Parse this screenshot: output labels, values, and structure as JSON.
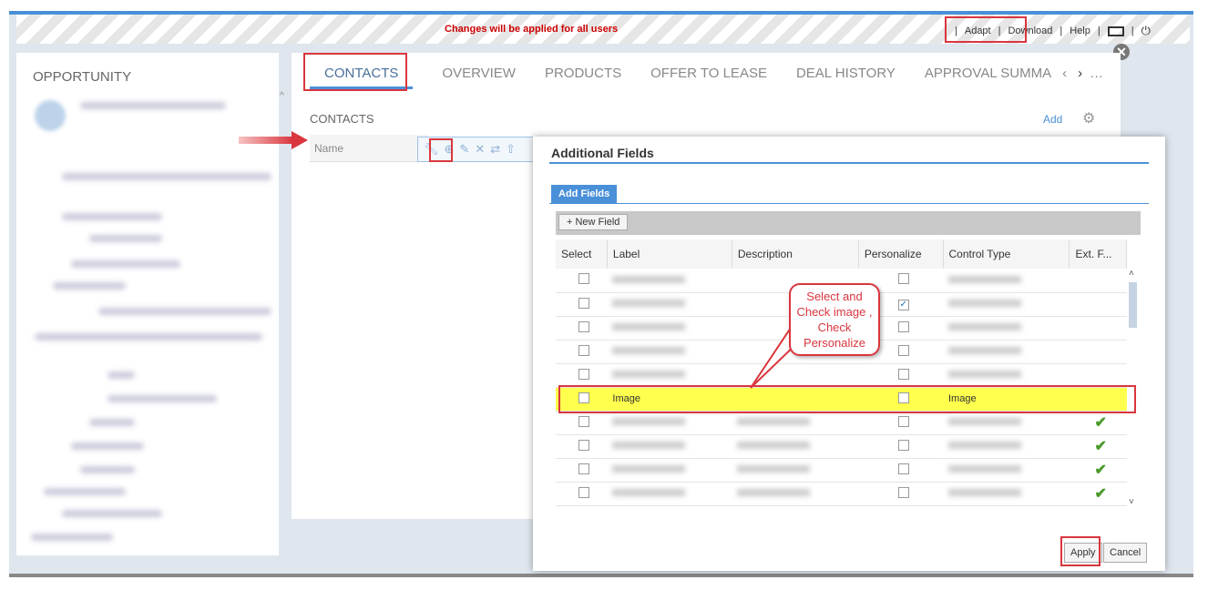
{
  "topbar": {
    "notice": "Changes will be applied for all users",
    "links": [
      "Adapt",
      "Download",
      "Help"
    ]
  },
  "left": {
    "title": "OPPORTUNITY"
  },
  "tabs": [
    "CONTACTS",
    "OVERVIEW",
    "PRODUCTS",
    "OFFER TO LEASE",
    "DEAL HISTORY",
    "APPROVAL SUMMA"
  ],
  "section": {
    "title": "CONTACTS",
    "add": "Add",
    "name_col": "Name"
  },
  "dialog": {
    "title": "Additional Fields",
    "tab": "Add Fields",
    "new_field": "New Field",
    "columns": [
      "Select",
      "Label",
      "Description",
      "Personalize",
      "Control Type",
      "Ext. F..."
    ],
    "rows": [
      {
        "label": "",
        "personalize": false,
        "ext": false
      },
      {
        "label": "",
        "personalize": true,
        "ext": false
      },
      {
        "label": "",
        "personalize": false,
        "ext": false
      },
      {
        "label": "",
        "personalize": false,
        "ext": false
      },
      {
        "label": "",
        "personalize": false,
        "ext": false
      },
      {
        "label": "Image",
        "control": "Image",
        "personalize": false,
        "ext": false,
        "highlight": true
      },
      {
        "label": "",
        "personalize": false,
        "ext": true
      },
      {
        "label": "",
        "personalize": false,
        "ext": true
      },
      {
        "label": "",
        "personalize": false,
        "ext": true
      },
      {
        "label": "",
        "personalize": false,
        "ext": true
      }
    ],
    "apply": "Apply",
    "cancel": "Cancel"
  },
  "callout": "Select and Check image , Check Personalize",
  "colors": {
    "accent": "#4a90d9",
    "annotation": "#d9363e",
    "highlight": "#ffff4d"
  }
}
